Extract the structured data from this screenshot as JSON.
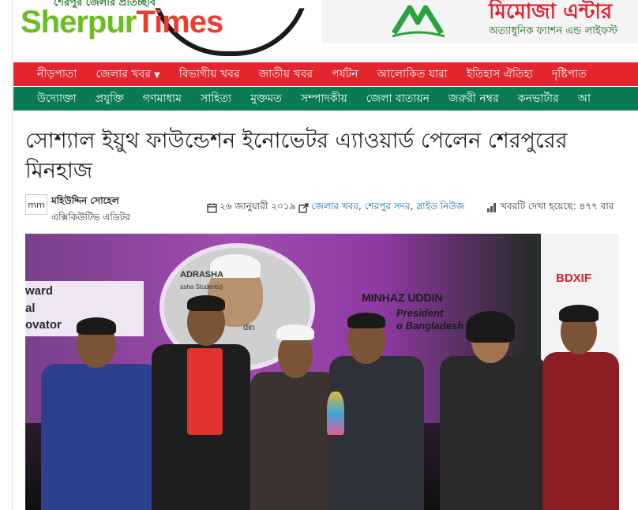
{
  "header": {
    "logo": {
      "tagline": "শেরপুর জেলার প্রতিচ্ছবি",
      "word_part1": "Sherpur",
      "word_part2": "Times"
    },
    "ad": {
      "brand": "মিমোজা এন্টার",
      "tagline": "অত্যাধুনিক ফ্যাশন এন্ড লাইফস্ট"
    }
  },
  "nav_primary": [
    {
      "label": "নীড়পাতা"
    },
    {
      "label": "জেলার খবর",
      "caret": "▼"
    },
    {
      "label": "বিভাগীয় খবর"
    },
    {
      "label": "জাতীয় খবর"
    },
    {
      "label": "পর্যটন"
    },
    {
      "label": "আলোকিত যারা"
    },
    {
      "label": "ইতিহাস ঐতিহ্য"
    },
    {
      "label": "দৃষ্টিপাত"
    }
  ],
  "nav_secondary": [
    {
      "label": "উদ্যোক্তা"
    },
    {
      "label": "প্রযুক্তি"
    },
    {
      "label": "গণমাধ্যম"
    },
    {
      "label": "সাহিত্য"
    },
    {
      "label": "মুক্তমত"
    },
    {
      "label": "সম্পাদকীয়"
    },
    {
      "label": "জেলা বাতায়ন"
    },
    {
      "label": "জরুরী নম্বর"
    },
    {
      "label": "কনভার্টার"
    },
    {
      "label": "আ"
    }
  ],
  "article": {
    "title": "সোশ্যাল ইয়ুথ ফাউন্ডেশন ইনোভেটর এ্যাওয়ার্ড পেলেন শেরপুরের মিনহাজ",
    "author": {
      "avatar": "mm",
      "name": "মহিউদ্দিন সোহেল",
      "role": "এক্সিকিউটিভ এডিটর"
    },
    "date": "২৬ জানুয়ারী ২০১৯",
    "categories": [
      "জেলার খবর",
      "শেরপুর সদর",
      "স্লাইড নিউজ"
    ],
    "separator": ", ",
    "views": "খবরটি দেখা হয়েছে: ৪৭৭ বার",
    "photo": {
      "portrait_text": "ADRASHA",
      "portrait_sub": "asha Students)",
      "portrait_name": "din",
      "banner_lines": [
        "ward",
        "al",
        "ovator"
      ],
      "screen_name": "MINHAZ UDDIN",
      "screen_title": "President",
      "screen_org": "o Bangladesh",
      "sponsor": "BDXIF"
    }
  },
  "colors": {
    "nav_primary_bg": "#e3262e",
    "nav_secondary_bg": "#087a55",
    "link": "#0b6eb5"
  },
  "icons": [
    "calendar-icon",
    "external-link-icon",
    "bar-chart-icon"
  ]
}
